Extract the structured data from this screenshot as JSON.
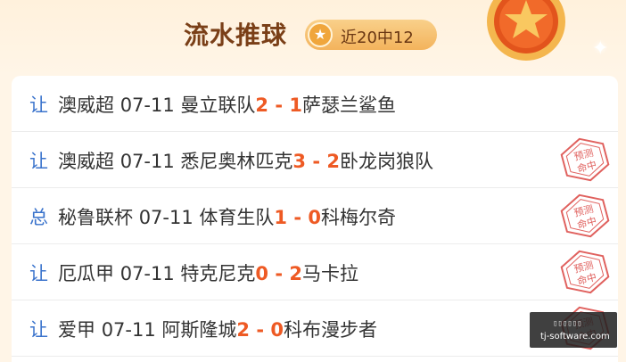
{
  "header": {
    "title": "流水推球",
    "record": "近20中12",
    "star_icon": "star-icon"
  },
  "rows": [
    {
      "type": "让",
      "league": "澳威超",
      "date": "07-11",
      "home": "曼立联队",
      "home_score": "2",
      "sep": " - ",
      "away_score": "1",
      "away": "萨瑟兰鲨鱼",
      "stamp": false
    },
    {
      "type": "让",
      "league": "澳威超",
      "date": "07-11",
      "home": "悉尼奥林匹克",
      "home_score": "3",
      "sep": " - ",
      "away_score": "2",
      "away": "卧龙岗狼队",
      "stamp": true
    },
    {
      "type": "总",
      "league": "秘鲁联杯",
      "date": "07-11",
      "home": "体育生队",
      "home_score": "1",
      "sep": " - ",
      "away_score": "0",
      "away": "科梅尔奇",
      "stamp": true
    },
    {
      "type": "让",
      "league": "厄瓜甲",
      "date": "07-11",
      "home": "特克尼克",
      "home_score": "0",
      "sep": " - ",
      "away_score": "2",
      "away": "马卡拉",
      "stamp": true
    },
    {
      "type": "让",
      "league": "爱甲",
      "date": "07-11",
      "home": "阿斯隆城",
      "home_score": "2",
      "sep": " - ",
      "away_score": "0",
      "away": "科布漫步者",
      "stamp": true
    }
  ],
  "stamp_text": {
    "line1": "预测",
    "line2": "命中"
  },
  "watermark": {
    "top": "▯▯▯▯▯▯",
    "text": "tj-software.com"
  },
  "colors": {
    "type": "#3a73cc",
    "score": "#ee5a24",
    "stamp": "#e0615e"
  }
}
